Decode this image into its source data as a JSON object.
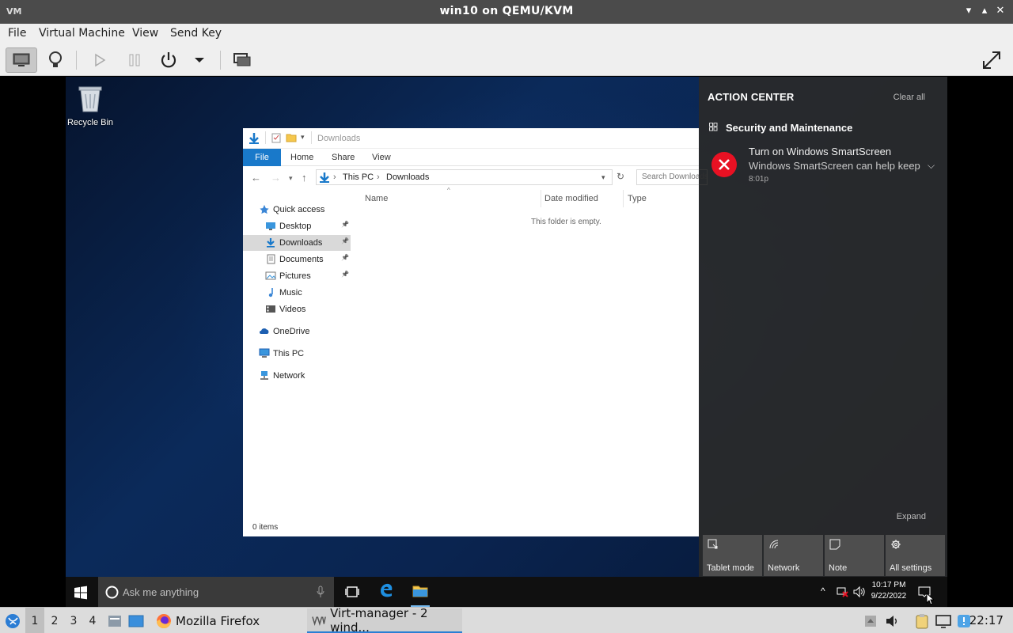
{
  "window": {
    "title": "win10 on QEMU/KVM",
    "app_icon": "VM",
    "minimize": "▾",
    "maximize": "▴",
    "close": "✕"
  },
  "menu": {
    "file": "File",
    "virtual_machine": "Virtual Machine",
    "view": "View",
    "send_key": "Send Key"
  },
  "desktop": {
    "recycle_bin": "Recycle Bin"
  },
  "explorer": {
    "title": "Downloads",
    "tabs": {
      "file": "File",
      "home": "Home",
      "share": "Share",
      "view": "View"
    },
    "address": {
      "this_pc": "This PC",
      "folder": "Downloads",
      "sep": "›"
    },
    "search_placeholder": "Search Downloads",
    "columns": {
      "name": "Name",
      "date_modified": "Date modified",
      "type": "Type"
    },
    "empty_message": "This folder is empty.",
    "status": "0 items",
    "nav": [
      {
        "label": "Quick access",
        "icon": "star-icon"
      },
      {
        "label": "Desktop",
        "icon": "desktop-icon",
        "pinned": true
      },
      {
        "label": "Downloads",
        "icon": "download-icon",
        "pinned": true,
        "selected": true
      },
      {
        "label": "Documents",
        "icon": "document-icon",
        "pinned": true
      },
      {
        "label": "Pictures",
        "icon": "pictures-icon",
        "pinned": true
      },
      {
        "label": "Music",
        "icon": "music-icon"
      },
      {
        "label": "Videos",
        "icon": "videos-icon"
      },
      {
        "label": "OneDrive",
        "icon": "cloud-icon"
      },
      {
        "label": "This PC",
        "icon": "computer-icon"
      },
      {
        "label": "Network",
        "icon": "network-icon"
      }
    ]
  },
  "action_center": {
    "title": "ACTION CENTER",
    "clear_all": "Clear all",
    "group": "Security and Maintenance",
    "notification": {
      "title": "Turn on Windows SmartScreen",
      "body": "Windows SmartScreen can help keep y",
      "time": "8:01p",
      "icon": "error-icon"
    },
    "expand": "Expand",
    "quick_actions": [
      {
        "label": "Tablet mode",
        "icon": "tablet-mode-icon"
      },
      {
        "label": "Network",
        "icon": "wifi-icon"
      },
      {
        "label": "Note",
        "icon": "note-icon"
      },
      {
        "label": "All settings",
        "icon": "settings-icon"
      }
    ]
  },
  "win_taskbar": {
    "search_placeholder": "Ask me anything",
    "time": "10:17 PM",
    "date": "9/22/2022"
  },
  "host_taskbar": {
    "desktops": [
      "1",
      "2",
      "3",
      "4"
    ],
    "active_desktop": "1",
    "firefox": "Mozilla Firefox",
    "virt_manager": "Virt-manager - 2 wind...",
    "clock": "22:17"
  },
  "colors": {
    "accent_blue": "#1979ca",
    "error_red": "#e81123",
    "host_active": "#2a7fd4"
  }
}
